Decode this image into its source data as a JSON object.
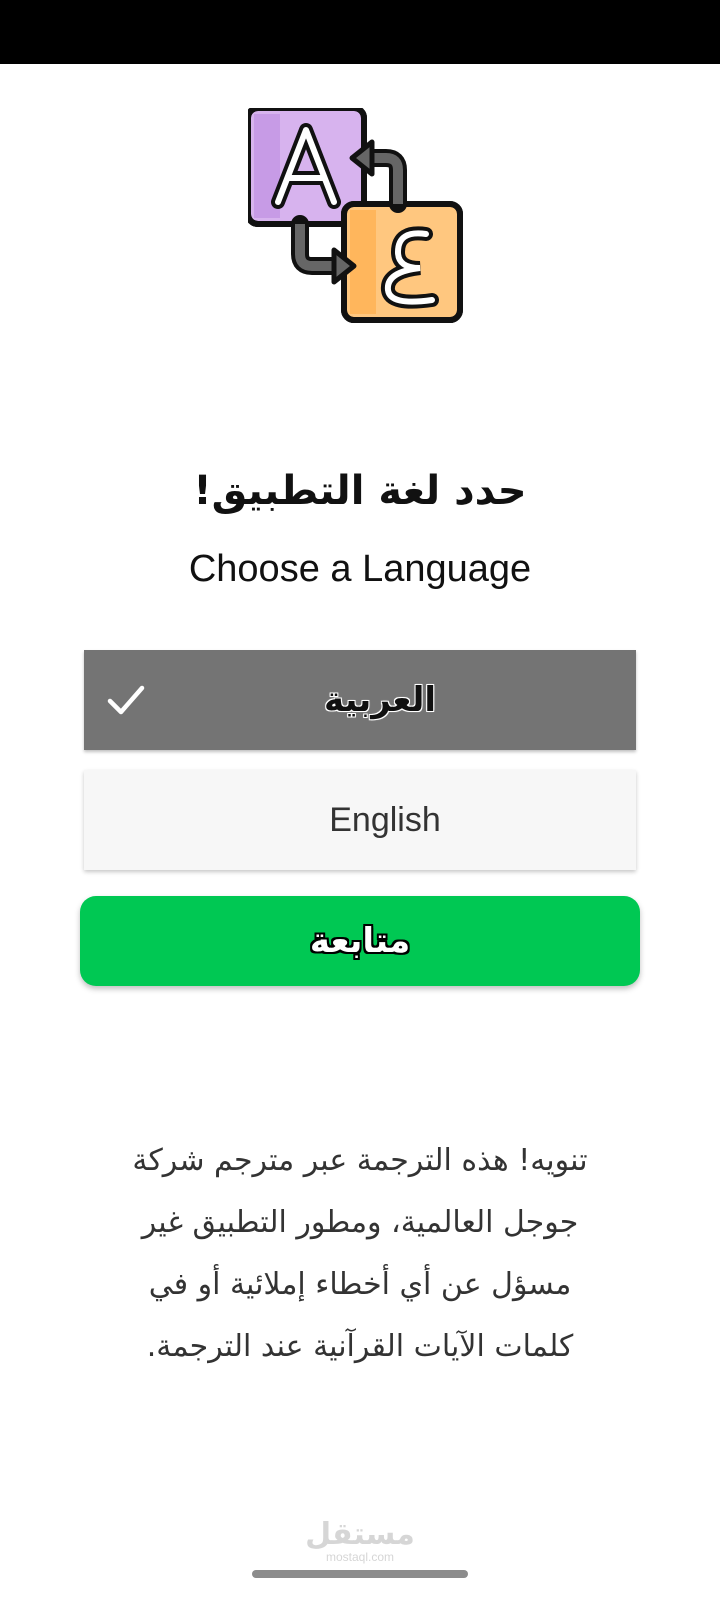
{
  "header": {
    "title_ar": "حدد لغة التطبيق!",
    "title_en": "Choose a Language",
    "logo_icon": "translate-a-ain-icon"
  },
  "languages": [
    {
      "label": "العربية",
      "selected": true
    },
    {
      "label": "English",
      "selected": false
    }
  ],
  "continue_label": "متابعة",
  "notice": "تنويه! هذه الترجمة عبر مترجم شركة جوجل العالمية، ومطور التطبيق غير مسؤل عن أي أخطاء إملائية أو في كلمات الآيات القرآنية عند الترجمة.",
  "watermark": {
    "ar": "مستقل",
    "en": "mostaql.com"
  },
  "colors": {
    "selected_bg": "#747474",
    "unselected_bg": "#f7f7f7",
    "continue_bg": "#00c853",
    "logo_purple": "#d7b3ee",
    "logo_orange": "#ffc77f"
  }
}
